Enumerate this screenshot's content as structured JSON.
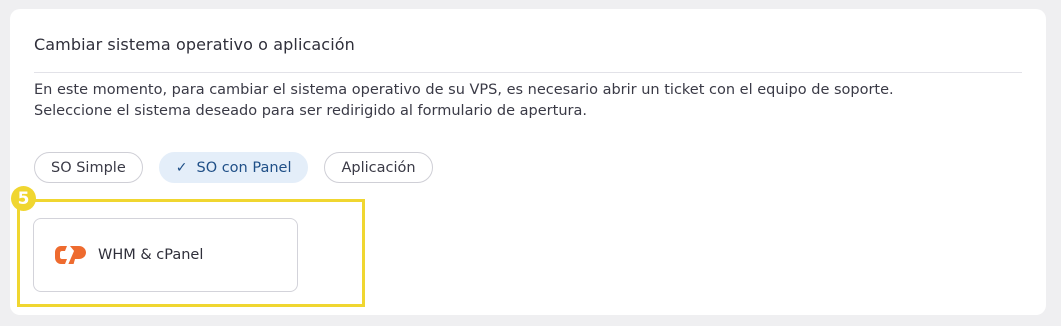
{
  "section": {
    "title": "Cambiar sistema operativo o aplicación",
    "description_line1": "En este momento, para cambiar el sistema operativo de su VPS, es necesario abrir un ticket con el equipo de soporte.",
    "description_line2": "Seleccione el sistema deseado para ser redirigido al formulario de apertura."
  },
  "tabs": [
    {
      "label": "SO Simple",
      "selected": false
    },
    {
      "label": "SO con Panel",
      "selected": true
    },
    {
      "label": "Aplicación",
      "selected": false
    }
  ],
  "annotation": {
    "step_number": "5",
    "color": "#f0d630"
  },
  "options": [
    {
      "label": "WHM & cPanel",
      "icon": "cpanel-logo-icon",
      "icon_color": "#ee6b2f"
    }
  ],
  "colors": {
    "selected_tab_bg": "#e4eef9",
    "selected_tab_text": "#1f4f87"
  }
}
